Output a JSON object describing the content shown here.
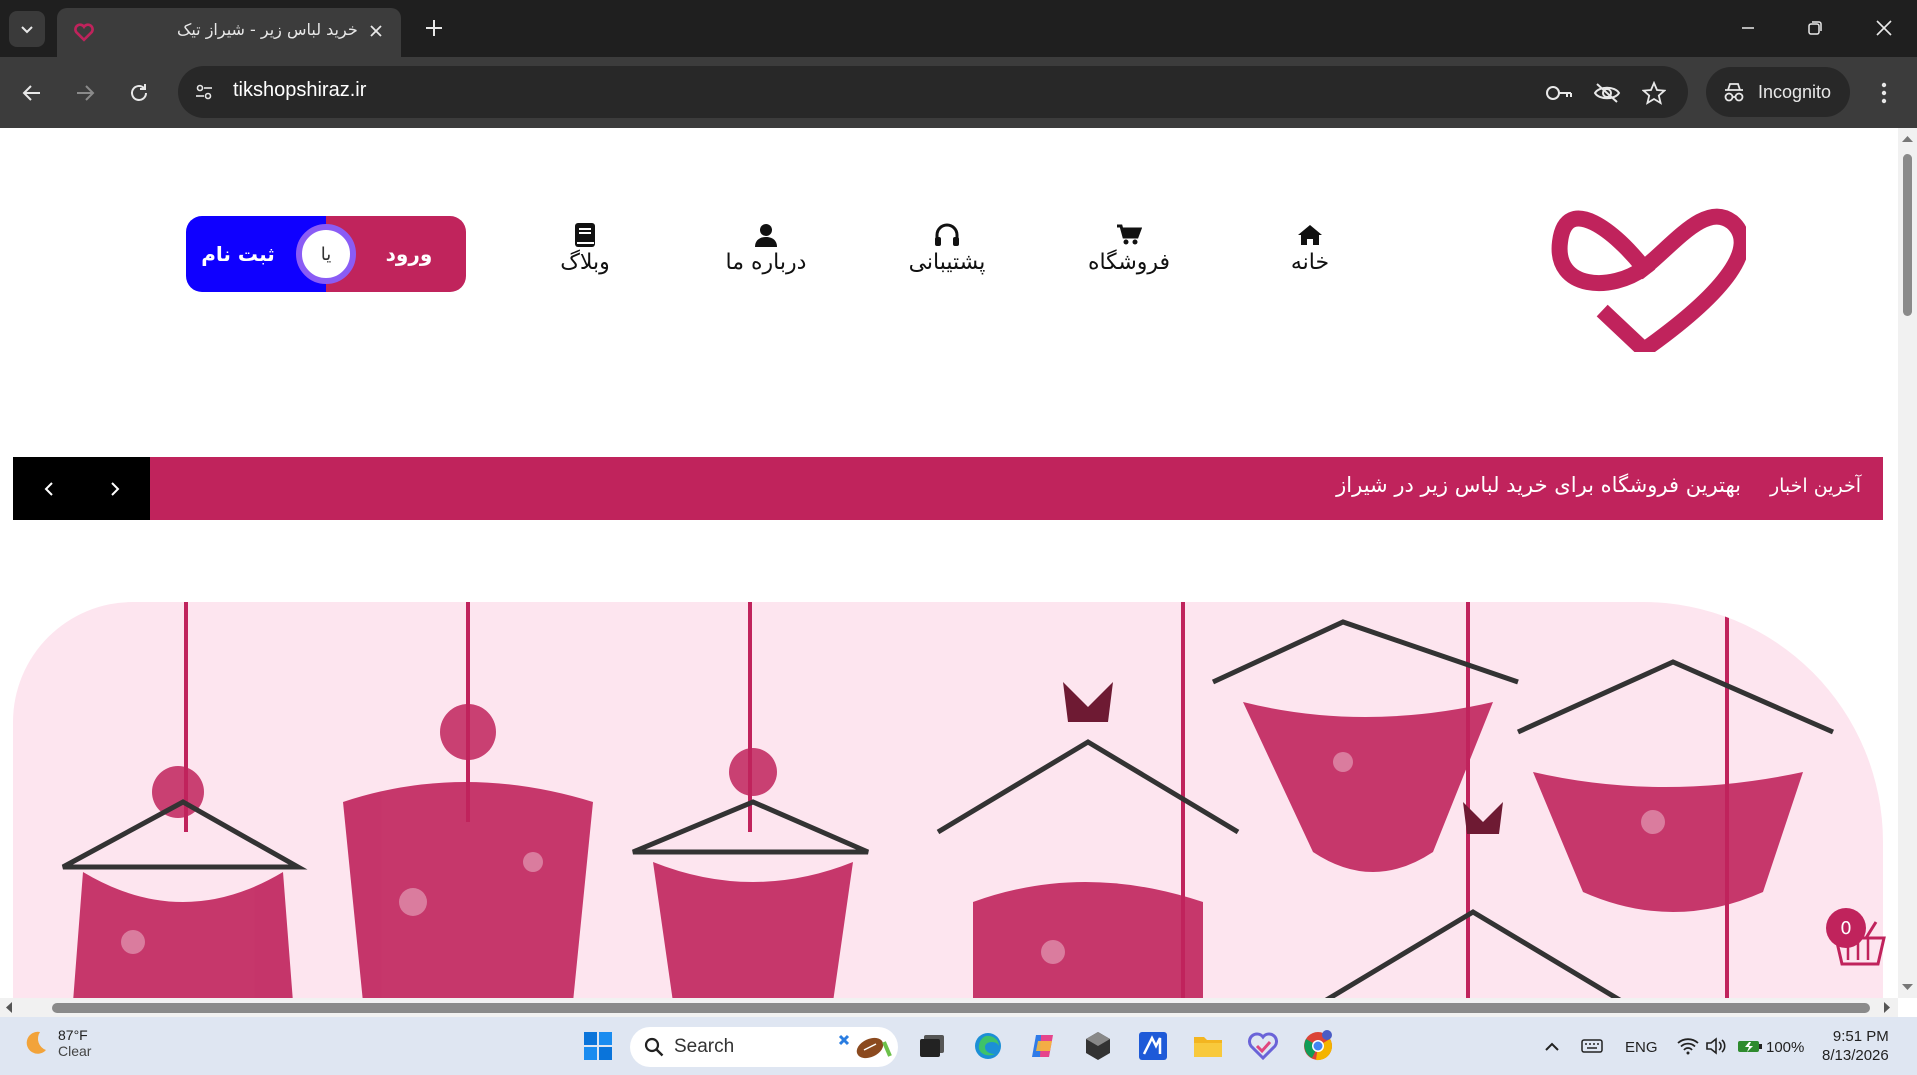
{
  "browser": {
    "tab_title": "خرید لباس زیر - شیراز تیک",
    "url": "tikshopshiraz.ir",
    "incognito_label": "Incognito"
  },
  "site": {
    "brand_color": "#c0235c",
    "nav": [
      {
        "label": "خانه",
        "icon": "home-icon"
      },
      {
        "label": "فروشگاه",
        "icon": "cart-icon"
      },
      {
        "label": "پشتیبانی",
        "icon": "headphones-icon"
      },
      {
        "label": "درباره ما",
        "icon": "user-icon"
      },
      {
        "label": "وبلاگ",
        "icon": "book-icon"
      }
    ],
    "auth": {
      "login_label": "ورود",
      "or_label": "یا",
      "register_label": "ثبت نام"
    },
    "news": {
      "label": "آخرین اخبار",
      "headline": "بهترین فروشگاه برای خرید لباس زیر در شیراز"
    },
    "cart": {
      "count": "0"
    }
  },
  "taskbar": {
    "weather_temp": "87°F",
    "weather_condition": "Clear",
    "search_label": "Search",
    "language": "ENG",
    "battery": "100%",
    "time": "9:51 PM",
    "date": "8/13/2026"
  }
}
